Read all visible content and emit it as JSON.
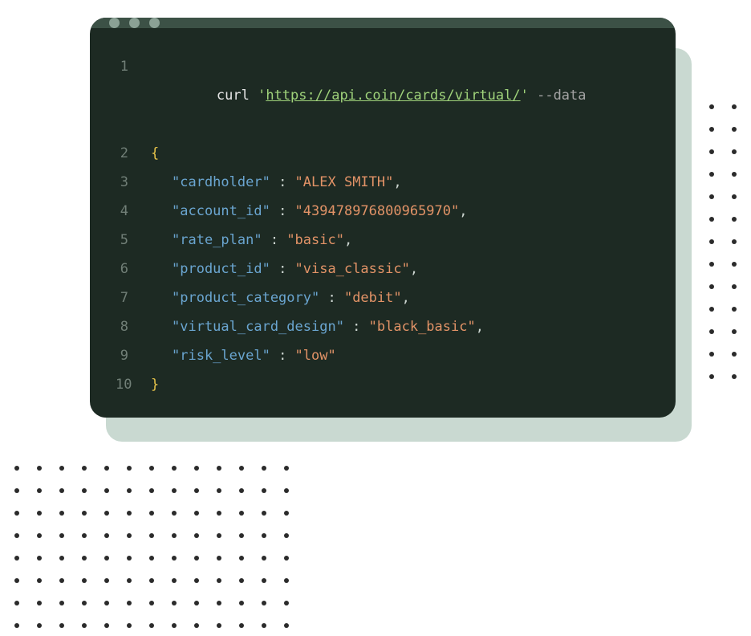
{
  "line_numbers": [
    "1",
    "2",
    "3",
    "4",
    "5",
    "6",
    "7",
    "8",
    "9",
    "10"
  ],
  "code": {
    "curl_cmd": "curl ",
    "url_quote_open": "'",
    "url": "https://api.coin/cards/virtual/",
    "url_quote_close": "'",
    "flag": " --data",
    "brace_open": "{",
    "brace_close": "}",
    "entries": [
      {
        "key": "\"cardholder\"",
        "value": "\"ALEX SMITH\"",
        "trailing": ","
      },
      {
        "key": "\"account_id\"",
        "value": "\"439478976800965970\"",
        "trailing": ","
      },
      {
        "key": "\"rate_plan\"",
        "value": "\"basic\"",
        "trailing": ","
      },
      {
        "key": "\"product_id\"",
        "value": "\"visa_classic\"",
        "trailing": ","
      },
      {
        "key": "\"product_category\"",
        "value": "\"debit\"",
        "trailing": ","
      },
      {
        "key": "\"virtual_card_design\"",
        "value": "\"black_basic\"",
        "trailing": ","
      },
      {
        "key": "\"risk_level\"",
        "value": "\"low\"",
        "trailing": ""
      }
    ],
    "colon": " : "
  }
}
